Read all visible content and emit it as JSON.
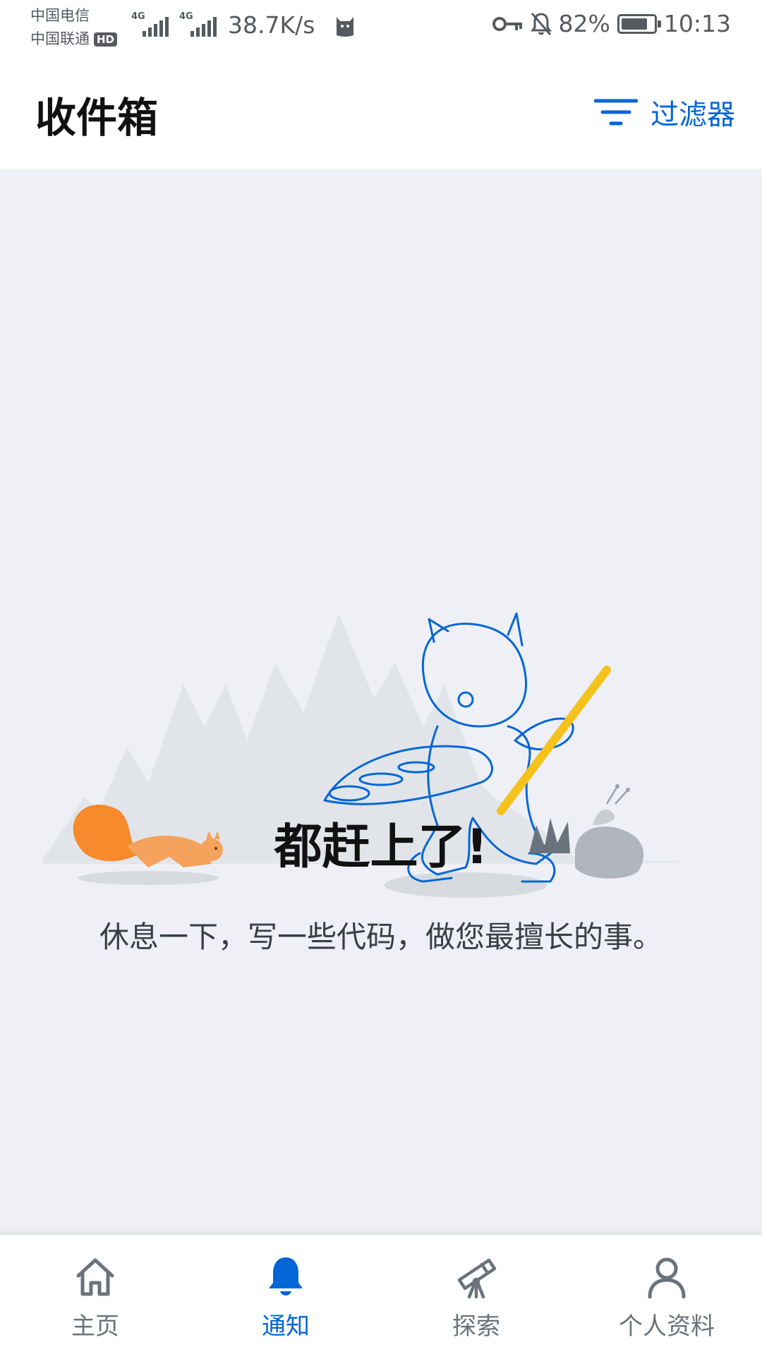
{
  "status_bar": {
    "carrier_1": "中国电信",
    "carrier_2": "中国联通",
    "hd_badge": "HD",
    "network_1": "4G",
    "network_2": "4G",
    "net_speed": "38.7K/s",
    "battery_percent": "82%",
    "battery_level": 0.82,
    "time": "10:13"
  },
  "header": {
    "title": "收件箱",
    "filter_label": "过滤器"
  },
  "empty_state": {
    "title": "都赶上了!",
    "subtitle": "休息一下，写一些代码，做您最擅长的事。"
  },
  "bottom_nav": {
    "items": [
      {
        "label": "主页",
        "icon": "home-icon",
        "active": false
      },
      {
        "label": "通知",
        "icon": "bell-icon",
        "active": true
      },
      {
        "label": "探索",
        "icon": "telescope-icon",
        "active": false
      },
      {
        "label": "个人资料",
        "icon": "person-icon",
        "active": false
      }
    ]
  },
  "colors": {
    "accent": "#0366d6",
    "background": "#eef0f5",
    "inactive": "#6a737d"
  }
}
